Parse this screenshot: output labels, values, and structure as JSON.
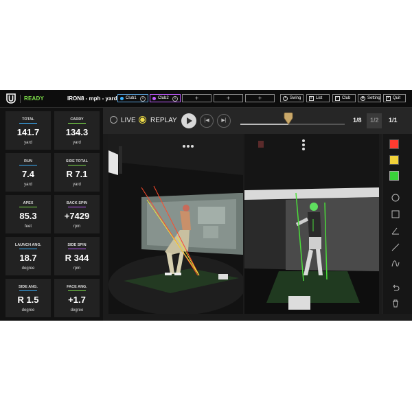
{
  "header": {
    "status": "READY",
    "title": "IRON8 - mph - yard",
    "clubs": [
      {
        "label": "Club1",
        "color": "#3bb2ff",
        "border": "#5aa0d8"
      },
      {
        "label": "Club2",
        "color": "#c05cff",
        "border": "#c05cff"
      }
    ],
    "add_symbol": "+",
    "buttons": [
      {
        "label": "Swing",
        "icon": "circle-dot-icon"
      },
      {
        "label": "List",
        "icon": "list-icon"
      },
      {
        "label": "Club",
        "icon": "club-icon"
      },
      {
        "label": "Setting",
        "icon": "gear-icon"
      },
      {
        "label": "Quit",
        "icon": "close-icon"
      }
    ]
  },
  "stats": [
    {
      "label": "TOTAL",
      "value": "141.7",
      "unit": "yard",
      "line": "#3bb2ff"
    },
    {
      "label": "CARRY",
      "value": "134.3",
      "unit": "yard",
      "line": "#7ee04a"
    },
    {
      "label": "RUN",
      "value": "7.4",
      "unit": "yard",
      "line": "#3bb2ff"
    },
    {
      "label": "SIDE TOTAL",
      "value": "R 7.1",
      "unit": "yard",
      "line": "#7ee04a"
    },
    {
      "label": "APEX",
      "value": "85.3",
      "unit": "feet",
      "line": "#7ee04a"
    },
    {
      "label": "BACK SPIN",
      "value": "+7429",
      "unit": "rpm",
      "line": "#c05cff"
    },
    {
      "label": "LAUNCH ANG.",
      "value": "18.7",
      "unit": "degree",
      "line": "#3bb2ff"
    },
    {
      "label": "SIDE SPIN",
      "value": "R 344",
      "unit": "rpm",
      "line": "#c05cff"
    },
    {
      "label": "SIDE ANG.",
      "value": "R 1.5",
      "unit": "degree",
      "line": "#3bb2ff"
    },
    {
      "label": "FACE ANG.",
      "value": "+1.7",
      "unit": "degree",
      "line": "#7ee04a"
    }
  ],
  "controls": {
    "live_label": "LIVE",
    "replay_label": "REPLAY",
    "replay_selected": true,
    "prev_symbol": "|◀",
    "next_symbol": "▶|",
    "progress": 0.46,
    "pages": [
      "1/8",
      "1/2",
      "1/1"
    ]
  },
  "colors": {
    "accent_green": "#7ee04a",
    "swatch_red": "#ff3b30",
    "swatch_yellow": "#f2d23a",
    "swatch_green": "#3ad33a"
  },
  "tools": [
    "circle-tool-icon",
    "square-tool-icon",
    "angle-tool-icon",
    "line-tool-icon",
    "curve-tool-icon",
    "undo-icon",
    "trash-icon"
  ]
}
